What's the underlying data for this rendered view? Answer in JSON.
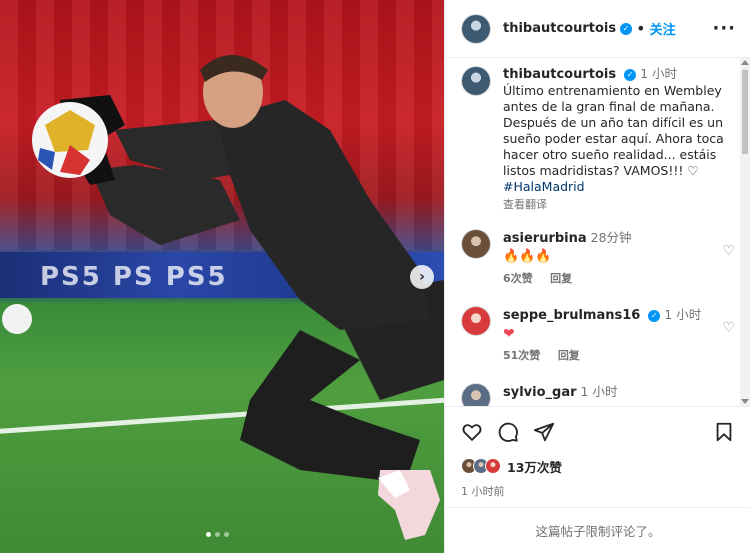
{
  "header": {
    "username": "thibautcourtois",
    "separator": "•",
    "follow_label": "关注",
    "more_label": "···",
    "verified_icon": "verified-badge-icon"
  },
  "photo": {
    "adboard_text": "PS5   PS   PS5",
    "next_label": "›",
    "dots": [
      {
        "active": true
      },
      {
        "active": false
      },
      {
        "active": false
      }
    ]
  },
  "caption": {
    "username": "thibautcourtois",
    "time": "1 小时",
    "text": "Último entrenamiento en Wembley antes de la gran final de mañana. Después de un año tan difícil es un sueño poder estar aquí. Ahora toca hacer otro sueño realidad... estáis listos madridistas? VAMOS!!! ♡",
    "hashtag": "#HalaMadrid",
    "translate": "查看翻译"
  },
  "comments": [
    {
      "username": "asierurbina",
      "time": "28分钟",
      "text": "🔥🔥🔥",
      "likes": "6次赞",
      "reply": "回复",
      "verified": false
    },
    {
      "username": "seppe_brulmans16",
      "time": "1 小时",
      "text": "❤",
      "likes": "51次赞",
      "reply": "回复",
      "verified": true
    },
    {
      "username": "sylvio_gar",
      "time": "1 小时",
      "text": "",
      "likes": "",
      "reply": "",
      "verified": false
    }
  ],
  "actions": {
    "like_icon": "heart-icon",
    "comment_icon": "comment-icon",
    "share_icon": "share-icon",
    "save_icon": "bookmark-icon",
    "likes_count": "13万次赞",
    "post_time": "1 小时前"
  },
  "footer": {
    "text": "这篇帖子限制评论了。"
  },
  "colors": {
    "accent": "#0095f6",
    "text": "#262626",
    "muted": "#737373",
    "like_red": "#ed4956"
  }
}
